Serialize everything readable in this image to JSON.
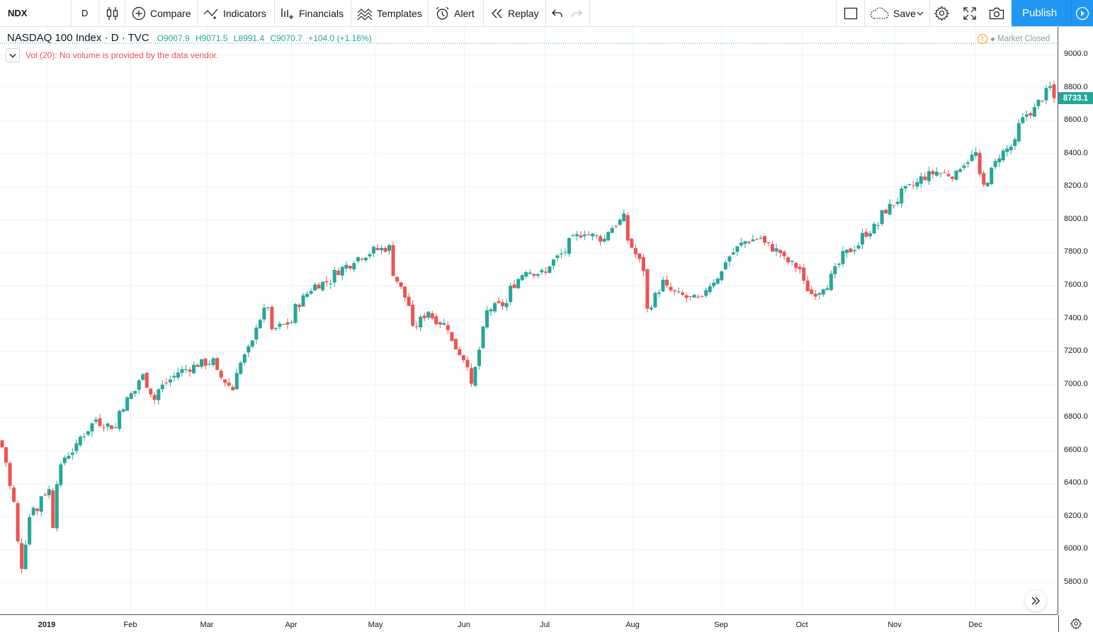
{
  "toolbar": {
    "symbol": "NDX",
    "interval": "D",
    "compare_label": "Compare",
    "indicators_label": "Indicators",
    "financials_label": "Financials",
    "templates_label": "Templates",
    "alert_label": "Alert",
    "replay_label": "Replay",
    "save_label": "Save",
    "publish_label": "Publish"
  },
  "legend": {
    "title": "NASDAQ 100 Index · D · TVC",
    "open": "O9007.9",
    "high": "H9071.5",
    "low": "L8991.4",
    "close": "C9070.7",
    "change": "+104.0 (+1.16%)",
    "volume_notice": "Vol (20): No volume is provided by the data vendor.",
    "market_status": "Market Closed"
  },
  "price_axis": {
    "ticks": [
      "9000.0",
      "8800.0",
      "8600.0",
      "8400.0",
      "8200.0",
      "8000.0",
      "7800.0",
      "7600.0",
      "7400.0",
      "7200.0",
      "7000.0",
      "6800.0",
      "6600.0",
      "6400.0",
      "6200.0",
      "6000.0",
      "5800.0"
    ],
    "last_price": "8733.1"
  },
  "time_axis": {
    "ticks": [
      "2019",
      "Feb",
      "Mar",
      "Apr",
      "May",
      "Jun",
      "Jul",
      "Aug",
      "Sep",
      "Oct",
      "Nov",
      "Dec"
    ]
  },
  "colors": {
    "up": "#26a69a",
    "down": "#ef5350",
    "accent": "#2196f3"
  },
  "chart_data": {
    "type": "candlestick",
    "symbol": "NASDAQ 100 Index",
    "ylim": [
      5650,
      9080
    ],
    "series_close": [
      {
        "date": "2018-12-17",
        "close": 6620
      },
      {
        "date": "2018-12-18",
        "close": 6530
      },
      {
        "date": "2018-12-19",
        "close": 6380
      },
      {
        "date": "2018-12-20",
        "close": 6280
      },
      {
        "date": "2018-12-21",
        "close": 6040
      },
      {
        "date": "2018-12-24",
        "close": 5900
      },
      {
        "date": "2018-12-26",
        "close": 6200
      },
      {
        "date": "2018-12-27",
        "close": 6270
      },
      {
        "date": "2018-12-28",
        "close": 6230
      },
      {
        "date": "2018-12-31",
        "close": 6330
      },
      {
        "date": "2019-01-02",
        "close": 6360
      },
      {
        "date": "2019-01-03",
        "close": 6150
      },
      {
        "date": "2019-01-04",
        "close": 6420
      },
      {
        "date": "2019-01-07",
        "close": 6490
      },
      {
        "date": "2019-01-08",
        "close": 6560
      },
      {
        "date": "2019-01-10",
        "close": 6600
      },
      {
        "date": "2019-01-15",
        "close": 6700
      },
      {
        "date": "2019-01-18",
        "close": 6790
      },
      {
        "date": "2019-01-25",
        "close": 6740
      },
      {
        "date": "2019-01-31",
        "close": 6940
      },
      {
        "date": "2019-02-05",
        "close": 7050
      },
      {
        "date": "2019-02-08",
        "close": 6910
      },
      {
        "date": "2019-02-15",
        "close": 7050
      },
      {
        "date": "2019-02-22",
        "close": 7110
      },
      {
        "date": "2019-03-01",
        "close": 7140
      },
      {
        "date": "2019-03-08",
        "close": 6970
      },
      {
        "date": "2019-03-15",
        "close": 7250
      },
      {
        "date": "2019-03-21",
        "close": 7480
      },
      {
        "date": "2019-03-22",
        "close": 7310
      },
      {
        "date": "2019-03-29",
        "close": 7380
      },
      {
        "date": "2019-04-05",
        "close": 7580
      },
      {
        "date": "2019-04-12",
        "close": 7630
      },
      {
        "date": "2019-04-18",
        "close": 7720
      },
      {
        "date": "2019-04-26",
        "close": 7800
      },
      {
        "date": "2019-05-03",
        "close": 7830
      },
      {
        "date": "2019-05-07",
        "close": 7630
      },
      {
        "date": "2019-05-13",
        "close": 7330
      },
      {
        "date": "2019-05-17",
        "close": 7450
      },
      {
        "date": "2019-05-24",
        "close": 7350
      },
      {
        "date": "2019-05-31",
        "close": 7130
      },
      {
        "date": "2019-06-03",
        "close": 6980
      },
      {
        "date": "2019-06-07",
        "close": 7440
      },
      {
        "date": "2019-06-14",
        "close": 7490
      },
      {
        "date": "2019-06-21",
        "close": 7700
      },
      {
        "date": "2019-06-28",
        "close": 7670
      },
      {
        "date": "2019-07-05",
        "close": 7810
      },
      {
        "date": "2019-07-12",
        "close": 7930
      },
      {
        "date": "2019-07-19",
        "close": 7880
      },
      {
        "date": "2019-07-26",
        "close": 8010
      },
      {
        "date": "2019-08-02",
        "close": 7700
      },
      {
        "date": "2019-08-05",
        "close": 7450
      },
      {
        "date": "2019-08-09",
        "close": 7620
      },
      {
        "date": "2019-08-15",
        "close": 7540
      },
      {
        "date": "2019-08-23",
        "close": 7510
      },
      {
        "date": "2019-08-30",
        "close": 7680
      },
      {
        "date": "2019-09-06",
        "close": 7850
      },
      {
        "date": "2019-09-13",
        "close": 7890
      },
      {
        "date": "2019-09-20",
        "close": 7800
      },
      {
        "date": "2019-09-27",
        "close": 7700
      },
      {
        "date": "2019-10-02",
        "close": 7550
      },
      {
        "date": "2019-10-08",
        "close": 7610
      },
      {
        "date": "2019-10-11",
        "close": 7730
      },
      {
        "date": "2019-10-18",
        "close": 7850
      },
      {
        "date": "2019-10-25",
        "close": 7970
      },
      {
        "date": "2019-11-01",
        "close": 8120
      },
      {
        "date": "2019-11-08",
        "close": 8220
      },
      {
        "date": "2019-11-15",
        "close": 8290
      },
      {
        "date": "2019-11-22",
        "close": 8270
      },
      {
        "date": "2019-11-29",
        "close": 8400
      },
      {
        "date": "2019-12-03",
        "close": 8200
      },
      {
        "date": "2019-12-06",
        "close": 8340
      },
      {
        "date": "2019-12-13",
        "close": 8460
      },
      {
        "date": "2019-12-18",
        "close": 8640
      },
      {
        "date": "2019-12-23",
        "close": 8710
      },
      {
        "date": "2019-12-26",
        "close": 8800
      },
      {
        "date": "2019-12-27",
        "close": 8733
      }
    ]
  }
}
